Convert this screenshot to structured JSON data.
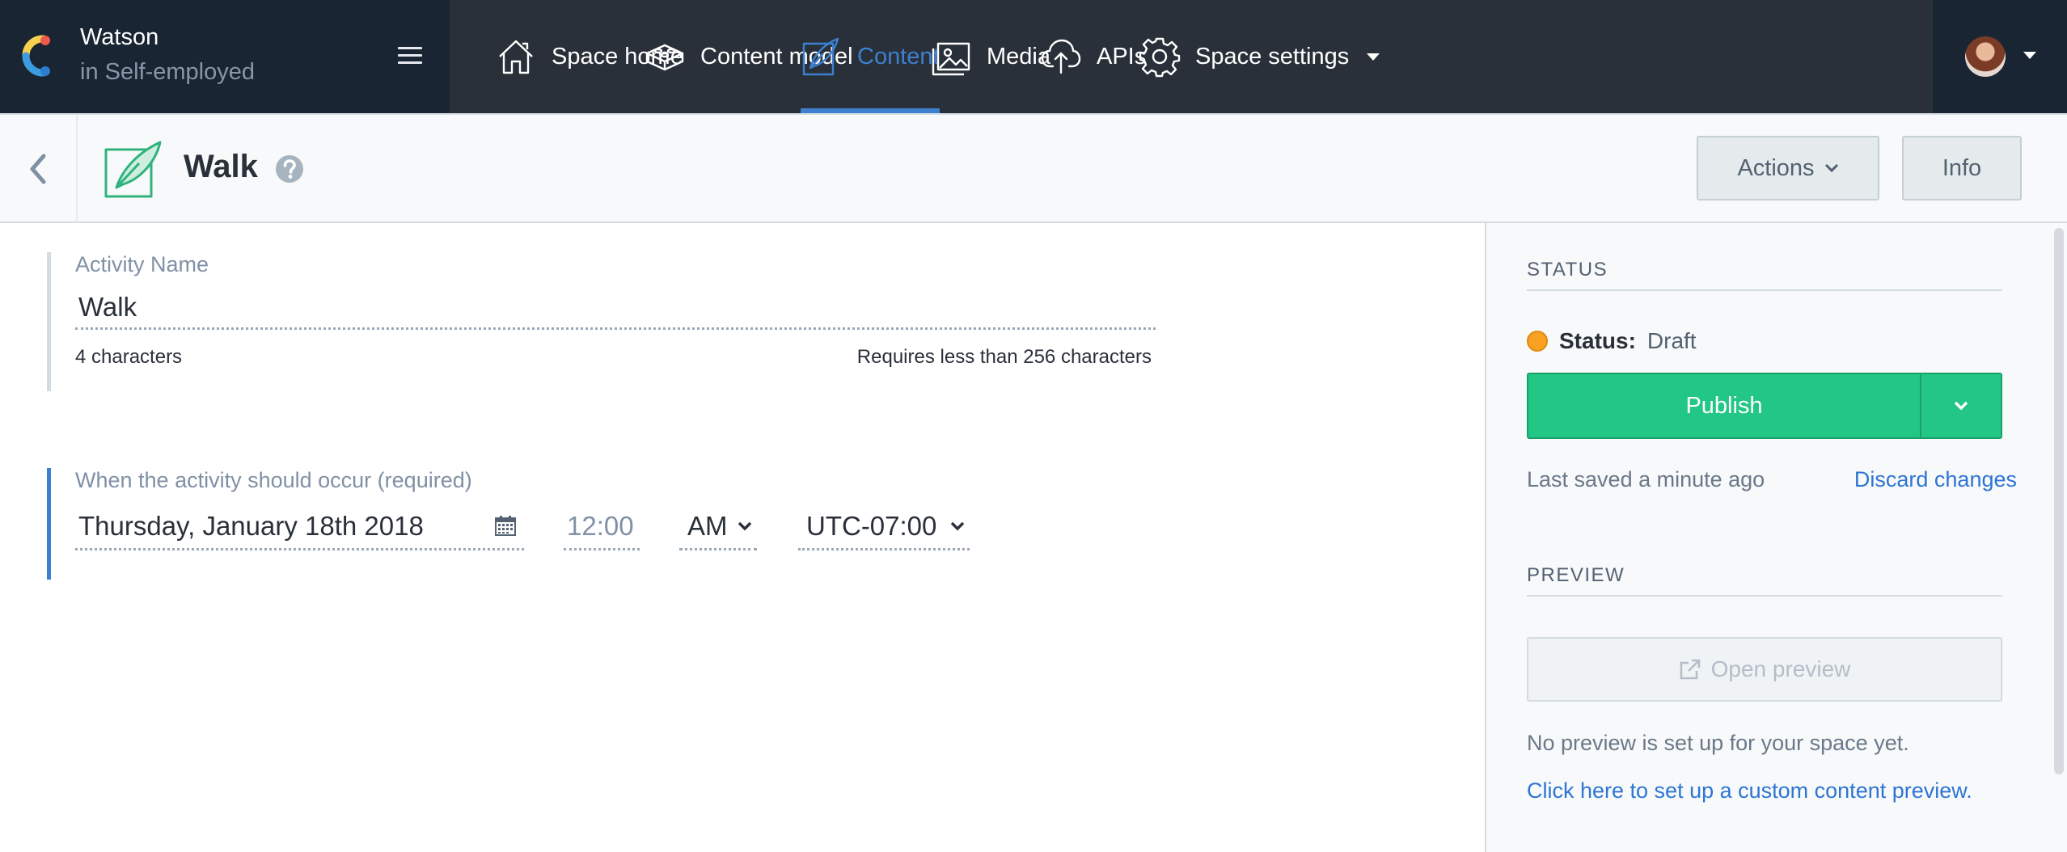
{
  "org": {
    "name": "Watson",
    "subtitle": "in Self-employed"
  },
  "nav": {
    "items": [
      {
        "label": "Space home",
        "icon": "home-icon"
      },
      {
        "label": "Content model",
        "icon": "content-model-icon"
      },
      {
        "label": "Content",
        "icon": "content-icon",
        "active": true
      },
      {
        "label": "Media",
        "icon": "media-icon"
      },
      {
        "label": "APIs",
        "icon": "cloud-api-icon"
      },
      {
        "label": "Space settings",
        "icon": "gear-icon"
      }
    ]
  },
  "entity": {
    "title": "Walk",
    "actions_label": "Actions",
    "info_label": "Info"
  },
  "fields": {
    "activity_name": {
      "label": "Activity Name",
      "value": "Walk",
      "count": "4 characters",
      "limit": "Requires less than 256 characters"
    },
    "occurrence": {
      "label": "When the activity should occur (required)",
      "date": "Thursday, January 18th 2018",
      "time_placeholder": "12:00",
      "ampm": "AM",
      "timezone": "UTC-07:00"
    }
  },
  "sidebar": {
    "status_heading": "STATUS",
    "status_key": "Status:",
    "status_value": "Draft",
    "publish_label": "Publish",
    "last_saved": "Last saved a minute ago",
    "discard_label": "Discard changes",
    "preview_heading": "PREVIEW",
    "open_preview_label": "Open preview",
    "no_preview_text": "No preview is set up for your space yet.",
    "setup_link": "Click here to set up a custom content preview."
  },
  "colors": {
    "nav_bg": "#2a3039",
    "org_bg": "#192532",
    "accent_blue": "#3c80cf",
    "publish_green": "#22c785",
    "draft_orange": "#f8a123",
    "link_blue": "#2e75d4"
  }
}
